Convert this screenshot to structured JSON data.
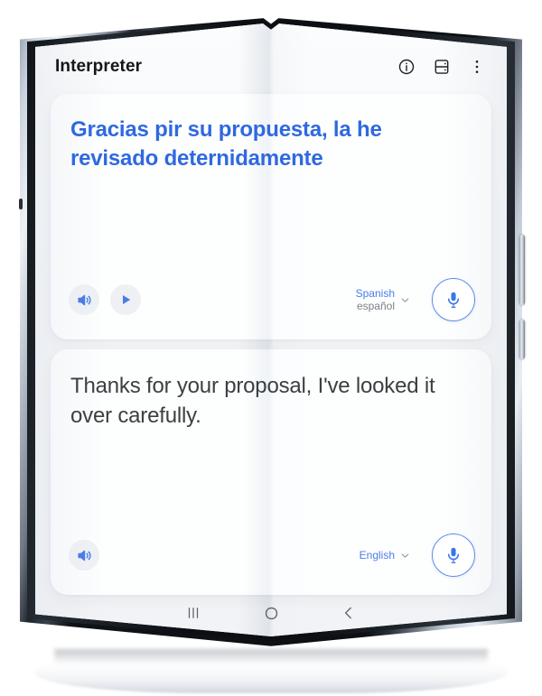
{
  "app": {
    "header": {
      "title": "Interpreter",
      "actions": [
        {
          "name": "info-icon",
          "label": "Info"
        },
        {
          "name": "split-view-icon",
          "label": "Split view"
        },
        {
          "name": "overflow-menu-icon",
          "label": "More options"
        }
      ]
    },
    "cards": {
      "source": {
        "text": "Gracias pir su propuesta, la he revisado deternidamente",
        "text_color": "#2f69e0",
        "controls": {
          "speaker_label": "Speaker",
          "play_label": "Play"
        },
        "language": {
          "name": "Spanish",
          "native": "español",
          "chevron": "chevron-down"
        },
        "mic_label": "Microphone"
      },
      "target": {
        "text": "Thanks for your proposal, I've looked it over carefully.",
        "text_color": "#3c4043",
        "controls": {
          "speaker_label": "Speaker"
        },
        "language": {
          "name": "English",
          "native": "",
          "chevron": "chevron-down"
        },
        "mic_label": "Microphone"
      }
    },
    "nav_bar": {
      "recents_label": "Recents",
      "home_label": "Home",
      "back_label": "Back"
    }
  },
  "theme": {
    "accent_blue": "#2f69e0",
    "mic_blue": "#3b76ea",
    "icon_blue": "#4a7de8",
    "card_bg": "#fdfefe",
    "screen_bg": "#f7f8fa",
    "text_dark": "#3c4043",
    "title_dark": "#141619",
    "muted_gray": "#7b8086"
  }
}
